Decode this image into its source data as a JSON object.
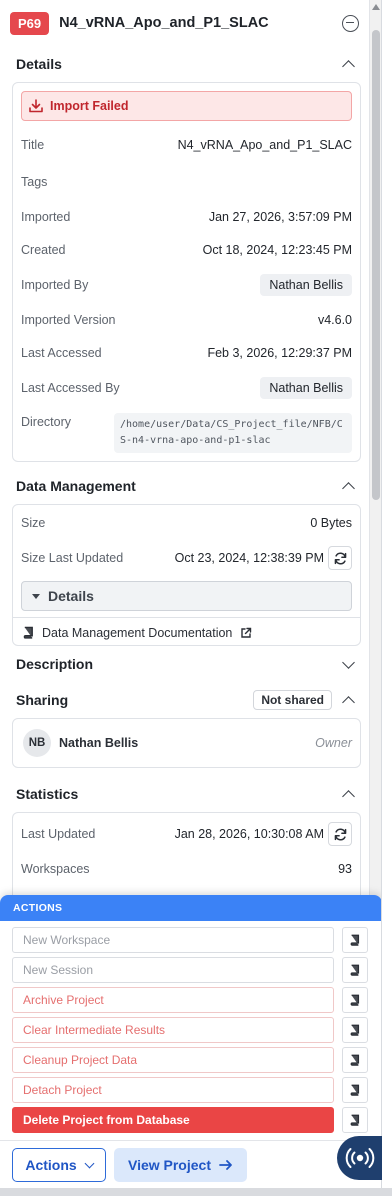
{
  "header": {
    "badge": "P69",
    "title": "N4_vRNA_Apo_and_P1_SLAC"
  },
  "details": {
    "section_title": "Details",
    "alert": "Import Failed",
    "rows": [
      {
        "label": "Title",
        "value": "N4_vRNA_Apo_and_P1_SLAC"
      },
      {
        "label": "Tags",
        "value": ""
      },
      {
        "label": "Imported",
        "value": "Jan 27, 2026, 3:57:09 PM"
      },
      {
        "label": "Created",
        "value": "Oct 18, 2024, 12:23:45 PM"
      },
      {
        "label": "Imported By",
        "value": "Nathan Bellis"
      },
      {
        "label": "Imported Version",
        "value": "v4.6.0"
      },
      {
        "label": "Last Accessed",
        "value": "Feb 3, 2026, 12:29:37 PM"
      },
      {
        "label": "Last Accessed By",
        "value": "Nathan Bellis"
      },
      {
        "label": "Directory",
        "value": "/home/user/Data/CS_Project_file/NFB/CS-n4-vrna-apo-and-p1-slac"
      }
    ]
  },
  "data_management": {
    "section_title": "Data Management",
    "size_label": "Size",
    "size_value": "0 Bytes",
    "size_updated_label": "Size Last Updated",
    "size_updated_value": "Oct 23, 2024, 12:38:39 PM",
    "details_toggle": "Details",
    "doc_link": "Data Management Documentation"
  },
  "description": {
    "section_title": "Description"
  },
  "sharing": {
    "section_title": "Sharing",
    "status": "Not shared",
    "user_initials": "NB",
    "user_name": "Nathan Bellis",
    "user_role": "Owner"
  },
  "statistics": {
    "section_title": "Statistics",
    "last_updated_label": "Last Updated",
    "last_updated_value": "Jan 28, 2026, 10:30:08 AM",
    "workspaces_label": "Workspaces",
    "workspaces_value": "93"
  },
  "actions": {
    "title": "ACTIONS",
    "items": [
      {
        "label": "New Workspace",
        "style": "disabled"
      },
      {
        "label": "New Session",
        "style": "disabled"
      },
      {
        "label": "Archive Project",
        "style": "warn"
      },
      {
        "label": "Clear Intermediate Results",
        "style": "warn"
      },
      {
        "label": "Cleanup Project Data",
        "style": "warn"
      },
      {
        "label": "Detach Project",
        "style": "warn"
      },
      {
        "label": "Delete Project from Database",
        "style": "danger"
      }
    ]
  },
  "footer": {
    "actions_button": "Actions",
    "view_button": "View Project"
  },
  "colors": {
    "badge": "#e5484d",
    "accent": "#3b82f6",
    "danger": "#ea4545"
  }
}
